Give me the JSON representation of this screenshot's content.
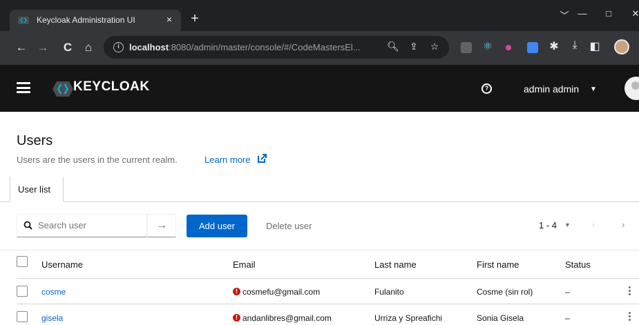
{
  "browser": {
    "tab_title": "Keycloak Administration UI",
    "tab_close": "×",
    "new_tab": "+",
    "window_controls": [
      "﹀",
      "—",
      "□",
      "✕"
    ],
    "url_host": "localhost",
    "url_rest": ":8080/admin/master/console/#/CodeMastersEl..."
  },
  "masthead": {
    "logo_text": "KEYCLOAK",
    "user_name": "admin admin",
    "user_caret": "▼"
  },
  "page": {
    "title": "Users",
    "description": "Users are the users in the current realm.",
    "learn_more": "Learn more"
  },
  "tabs": [
    {
      "label": "User list"
    }
  ],
  "toolbar": {
    "search_placeholder": "Search user",
    "search_go": "→",
    "add_user": "Add user",
    "delete_user": "Delete user",
    "pagination": "1 - 4",
    "caret": "▼",
    "prev": "‹",
    "next": "›"
  },
  "table": {
    "columns": [
      "Username",
      "Email",
      "Last name",
      "First name",
      "Status"
    ],
    "rows": [
      {
        "username": "cosme",
        "email": "cosmefu@gmail.com",
        "last_name": "Fulanito",
        "first_name": "Cosme (sin rol)",
        "status": "–"
      },
      {
        "username": "gisela",
        "email": "andanlibres@gmail.com",
        "last_name": "Urriza y Spreafichi",
        "first_name": "Sonia Gisela",
        "status": "–"
      }
    ]
  },
  "colors": {
    "masthead": "#151515",
    "primary": "#0066cc",
    "warning": "#c9190b"
  }
}
